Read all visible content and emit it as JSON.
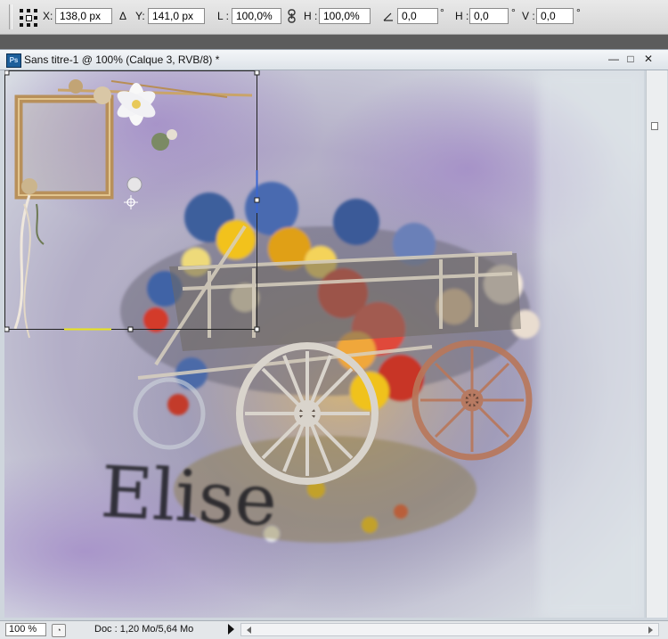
{
  "options_bar": {
    "x_label": "X:",
    "x_value": "138,0 px",
    "delta_label": "Δ",
    "y_label": "Y:",
    "y_value": "141,0 px",
    "w_label": "L :",
    "w_value": "100,0%",
    "h_label": "H :",
    "h_value": "100,0%",
    "angle_value": "0,0",
    "skew_h_label": "H :",
    "skew_h_value": "0,0",
    "skew_v_label": "V :",
    "skew_v_value": "0,0",
    "degree_symbol": "°"
  },
  "document": {
    "app_badge": "Ps",
    "title": "Sans titre-1 @ 100% (Calque 3, RVB/8) *",
    "minimize_glyph": "—",
    "maximize_glyph": "□",
    "close_glyph": "✕"
  },
  "canvas": {
    "signature_text": "Elise"
  },
  "status_bar": {
    "zoom": "100 %",
    "doc_info": "Doc : 1,20 Mo/5,64 Mo"
  },
  "colors": {
    "accent_purple": "#a98fcb",
    "sky_blue": "#c7d3dc",
    "flower_red": "#d33a2b",
    "flower_yellow": "#f2c21b",
    "flower_blue": "#3e5e9c"
  }
}
